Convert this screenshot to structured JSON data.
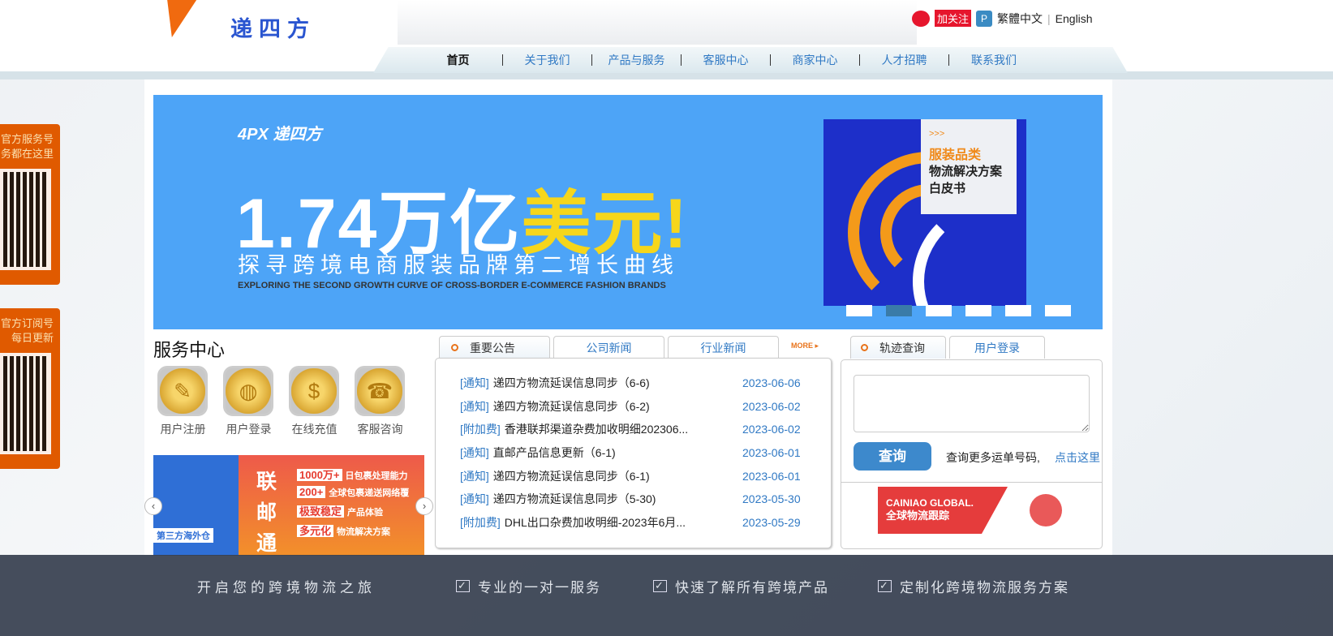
{
  "header": {
    "logo_text": "递四方",
    "follow": "加关注",
    "trad_chinese": "繁體中文",
    "divider": "|",
    "english": "English"
  },
  "nav": [
    "首页",
    "关于我们",
    "产品与服务",
    "客服中心",
    "商家中心",
    "人才招聘",
    "联系我们"
  ],
  "banner": {
    "brand": "4PX 递四方",
    "headline_white": "1.74万亿",
    "headline_yellow": "美元!",
    "subtitle": "探寻跨境电商服装品牌第二增长曲线",
    "english": "EXPLORING THE SECOND GROWTH CURVE OF CROSS-BORDER E-COMMERCE FASHION BRANDS",
    "card_arrows": ">>>",
    "card_line1": "服装品类",
    "card_line2": "物流解决方案",
    "card_line3": "白皮书",
    "slides": 6,
    "active_slide": 2
  },
  "sidebar": {
    "box1_line1": "官方服务号",
    "box1_line2": "务都在这里",
    "box2_line1": "官方订阅号",
    "box2_line2": "每日更新"
  },
  "service": {
    "title": "服务中心",
    "items": [
      "用户注册",
      "用户登录",
      "在线充值",
      "客服咨询"
    ]
  },
  "promo": {
    "blue_label": "第三方海外仓",
    "big": "联邮通",
    "rows": [
      {
        "b": "1000万+",
        "t": "日包裹处理能力"
      },
      {
        "b": "200+",
        "t": "全球包裹递送网络覆"
      },
      {
        "b": "极致稳定",
        "t": "产品体验"
      },
      {
        "b": "多元化",
        "t": "物流解决方案"
      }
    ],
    "prev": "‹",
    "next": "›"
  },
  "news": {
    "tabs": [
      "重要公告",
      "公司新闻",
      "行业新闻"
    ],
    "more": "MORE ▸",
    "items": [
      {
        "tag": "[通知]",
        "title": "递四方物流延误信息同步（6-6)",
        "date": "2023-06-06"
      },
      {
        "tag": "[通知]",
        "title": "递四方物流延误信息同步（6-2)",
        "date": "2023-06-02"
      },
      {
        "tag": "[附加费]",
        "title": "香港联邦渠道杂费加收明细202306...",
        "date": "2023-06-02"
      },
      {
        "tag": "[通知]",
        "title": "直邮产品信息更新（6-1)",
        "date": "2023-06-01"
      },
      {
        "tag": "[通知]",
        "title": "递四方物流延误信息同步（6-1)",
        "date": "2023-06-01"
      },
      {
        "tag": "[通知]",
        "title": "递四方物流延误信息同步（5-30)",
        "date": "2023-05-30"
      },
      {
        "tag": "[附加费]",
        "title": "DHL出口杂费加收明细-2023年6月...",
        "date": "2023-05-29"
      }
    ]
  },
  "track": {
    "tabs": [
      "轨迹查询",
      "用户登录"
    ],
    "input_value": "",
    "button": "查询",
    "more_text": "查询更多运单号码,",
    "more_link": "点击这里",
    "cainiao_line1": "CAINIAO GLOBAL.",
    "cainiao_line2": "全球物流跟踪"
  },
  "footer": {
    "title": "开启您的跨境物流之旅",
    "items": [
      "专业的一对一服务",
      "快速了解所有跨境产品",
      "定制化跨境物流服务方案"
    ],
    "check": "✓"
  }
}
